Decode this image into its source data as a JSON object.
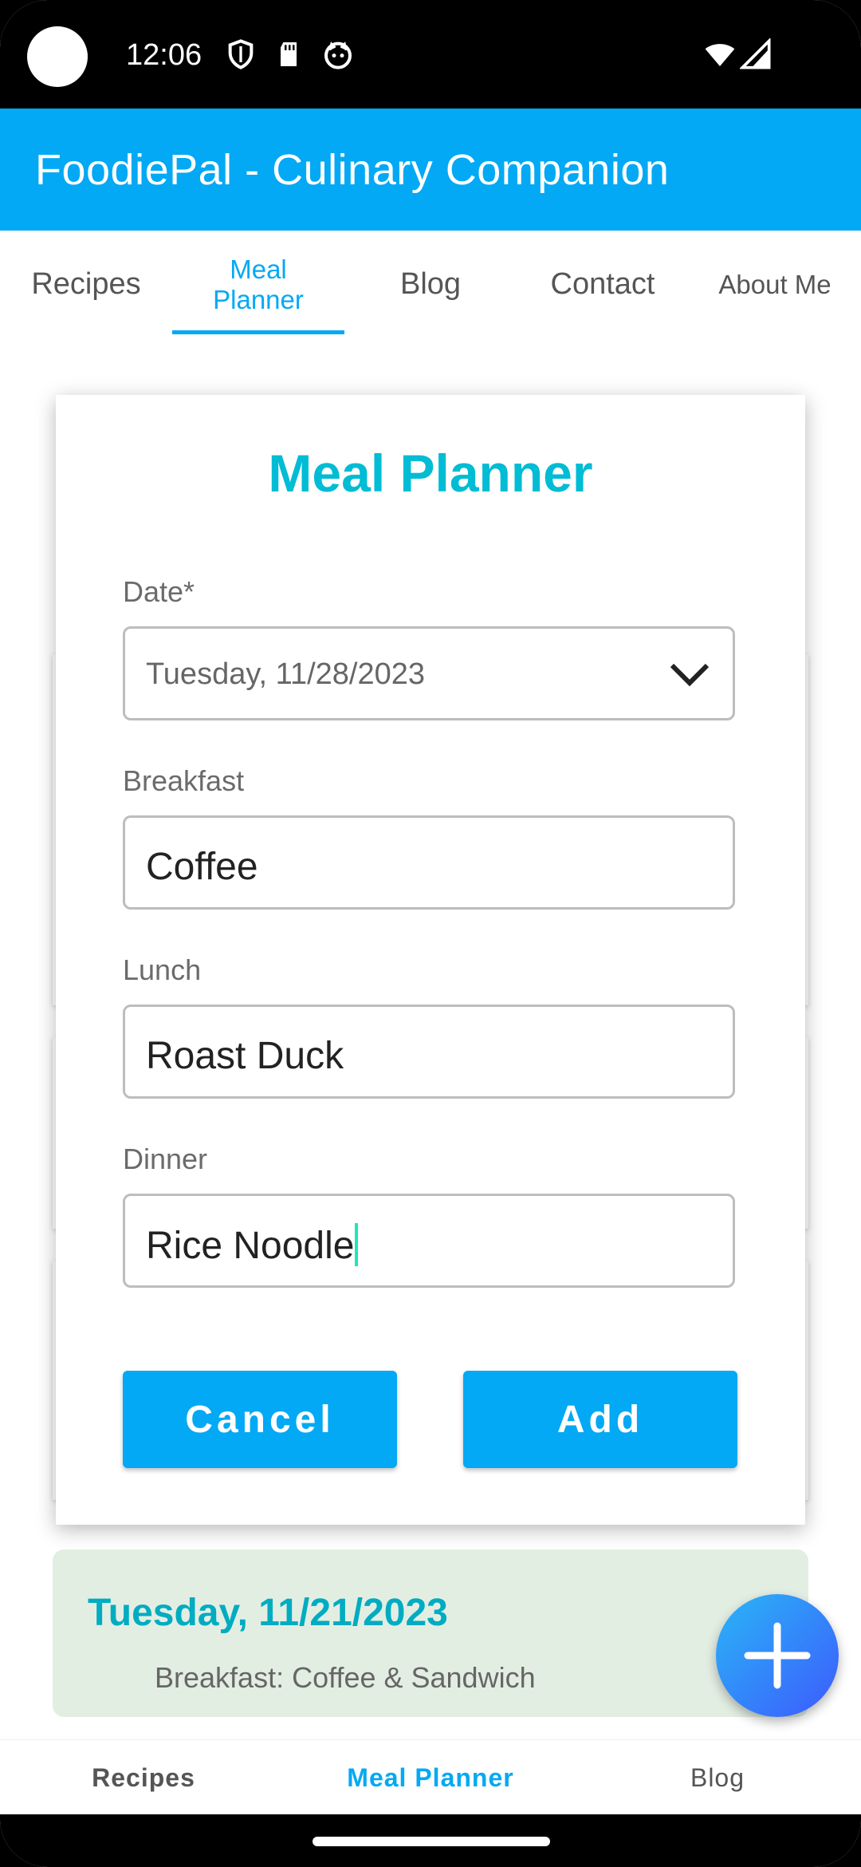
{
  "status_bar": {
    "time": "12:06",
    "icons": [
      "shield-icon",
      "sd-card-icon",
      "cat-face-icon",
      "wifi-icon",
      "signal-icon"
    ]
  },
  "app_bar": {
    "title": "FoodiePal - Culinary Companion",
    "color": "#03A9F4"
  },
  "tabs": [
    {
      "label": "Recipes",
      "active": false
    },
    {
      "label": "Meal Planner",
      "active": true
    },
    {
      "label": "Blog",
      "active": false
    },
    {
      "label": "Contact",
      "active": false
    },
    {
      "label": "About Me",
      "active": false
    }
  ],
  "dialog": {
    "title": "Meal Planner",
    "date_label": "Date*",
    "date_value": "Tuesday, 11/28/2023",
    "breakfast_label": "Breakfast",
    "breakfast_value": "Coffee",
    "lunch_label": "Lunch",
    "lunch_value": "Roast Duck",
    "dinner_label": "Dinner",
    "dinner_value": "Rice Noodle",
    "cancel_label": "Cancel",
    "add_label": "Add"
  },
  "entries": [
    {
      "date": "Tuesday, 11/21/2023",
      "breakfast_line": "Breakfast: Coffee & Sandwich"
    }
  ],
  "fab_icon": "plus-icon",
  "bottom_nav": [
    {
      "label": "Recipes",
      "active": false
    },
    {
      "label": "Meal Planner",
      "active": true
    },
    {
      "label": "Blog",
      "active": false
    }
  ],
  "colors": {
    "accent": "#03A9F4",
    "title_teal": "#00BCD4",
    "entry_bg": "#e3eee3"
  }
}
